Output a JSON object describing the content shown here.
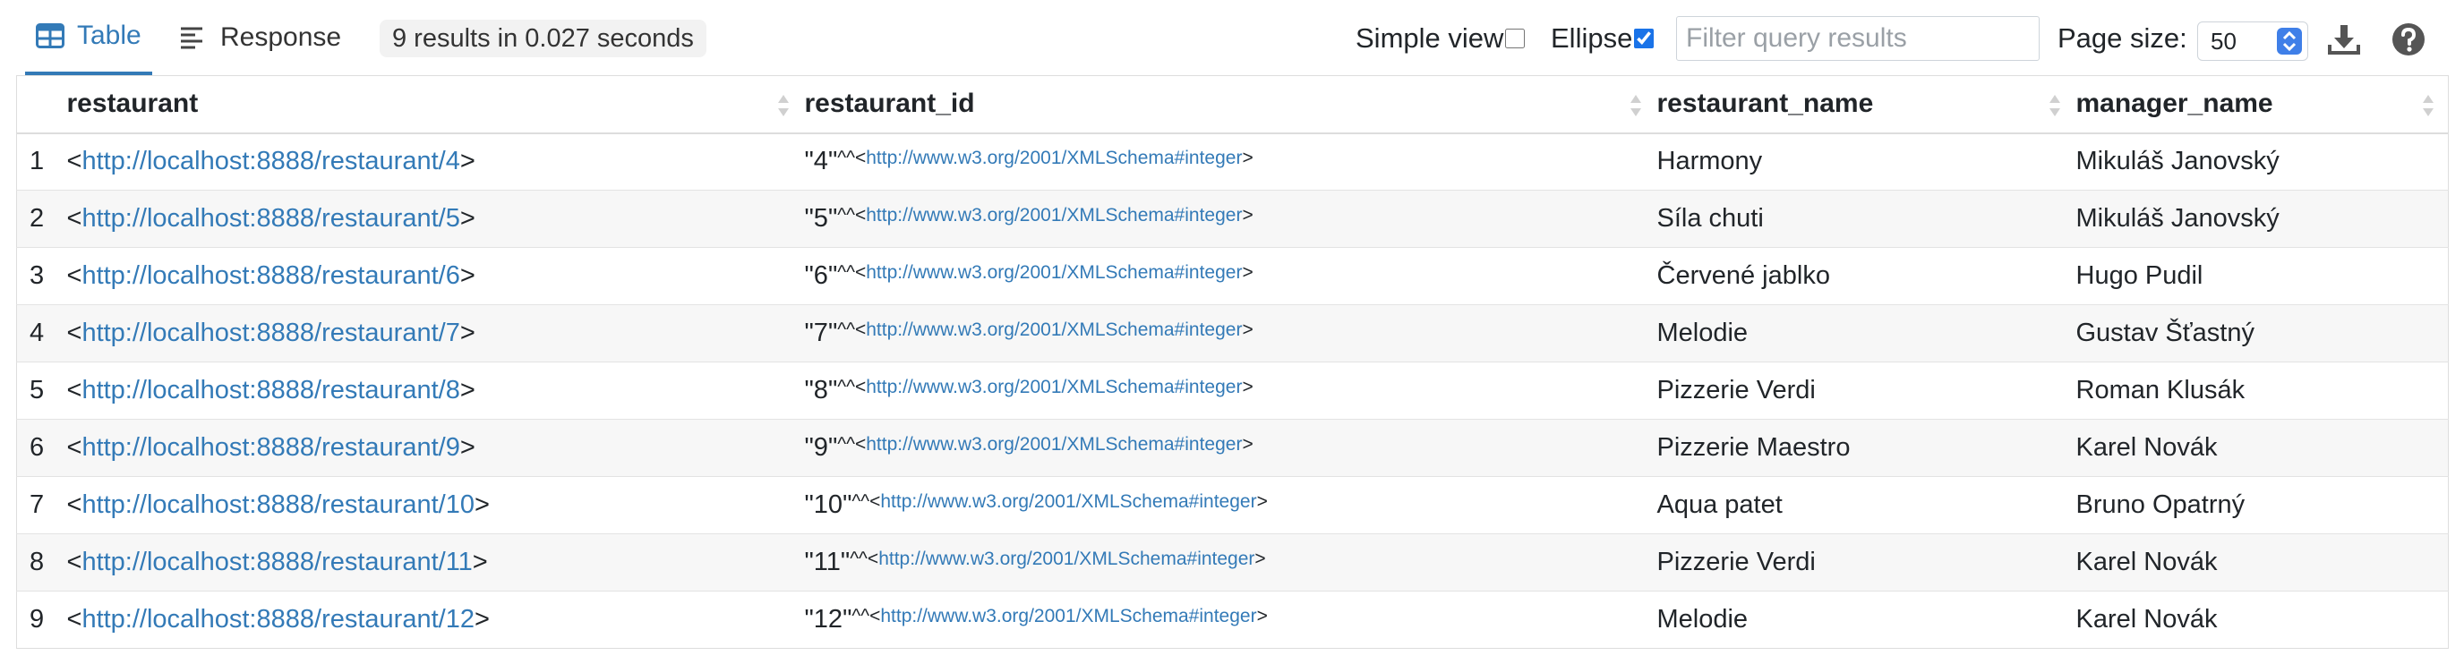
{
  "toolbar": {
    "tabs": [
      {
        "label": "Table",
        "icon": "table-icon",
        "active": true
      },
      {
        "label": "Response",
        "icon": "lines-icon",
        "active": false
      }
    ],
    "results_summary": "9 results in 0.027 seconds",
    "simple_view_label": "Simple view",
    "simple_view_checked": false,
    "ellipse_label": "Ellipse",
    "ellipse_checked": true,
    "filter_placeholder": "Filter query results",
    "page_size_label": "Page size:",
    "page_size_value": "50",
    "download_icon": "download-icon",
    "help_icon": "question-circle-icon"
  },
  "table": {
    "columns": [
      "restaurant",
      "restaurant_id",
      "restaurant_name",
      "manager_name"
    ],
    "rows": [
      {
        "index": "1",
        "restaurant": "http://localhost:8888/restaurant/4",
        "restaurant_id": "4",
        "datatype": "http://www.w3.org/2001/XMLSchema#integer",
        "restaurant_name": "Harmony",
        "manager_name": "Mikuláš Janovský"
      },
      {
        "index": "2",
        "restaurant": "http://localhost:8888/restaurant/5",
        "restaurant_id": "5",
        "datatype": "http://www.w3.org/2001/XMLSchema#integer",
        "restaurant_name": "Síla chuti",
        "manager_name": "Mikuláš Janovský"
      },
      {
        "index": "3",
        "restaurant": "http://localhost:8888/restaurant/6",
        "restaurant_id": "6",
        "datatype": "http://www.w3.org/2001/XMLSchema#integer",
        "restaurant_name": "Červené jablko",
        "manager_name": "Hugo Pudil"
      },
      {
        "index": "4",
        "restaurant": "http://localhost:8888/restaurant/7",
        "restaurant_id": "7",
        "datatype": "http://www.w3.org/2001/XMLSchema#integer",
        "restaurant_name": "Melodie",
        "manager_name": "Gustav Šťastný"
      },
      {
        "index": "5",
        "restaurant": "http://localhost:8888/restaurant/8",
        "restaurant_id": "8",
        "datatype": "http://www.w3.org/2001/XMLSchema#integer",
        "restaurant_name": "Pizzerie Verdi",
        "manager_name": "Roman Klusák"
      },
      {
        "index": "6",
        "restaurant": "http://localhost:8888/restaurant/9",
        "restaurant_id": "9",
        "datatype": "http://www.w3.org/2001/XMLSchema#integer",
        "restaurant_name": "Pizzerie Maestro",
        "manager_name": "Karel Novák"
      },
      {
        "index": "7",
        "restaurant": "http://localhost:8888/restaurant/10",
        "restaurant_id": "10",
        "datatype": "http://www.w3.org/2001/XMLSchema#integer",
        "restaurant_name": "Aqua patet",
        "manager_name": "Bruno Opatrný"
      },
      {
        "index": "8",
        "restaurant": "http://localhost:8888/restaurant/11",
        "restaurant_id": "11",
        "datatype": "http://www.w3.org/2001/XMLSchema#integer",
        "restaurant_name": "Pizzerie Verdi",
        "manager_name": "Karel Novák"
      },
      {
        "index": "9",
        "restaurant": "http://localhost:8888/restaurant/12",
        "restaurant_id": "12",
        "datatype": "http://www.w3.org/2001/XMLSchema#integer",
        "restaurant_name": "Melodie",
        "manager_name": "Karel Novák"
      }
    ]
  },
  "colors": {
    "accent": "#337ab7",
    "stripe": "#f7f7f7",
    "border": "#dddddd"
  }
}
